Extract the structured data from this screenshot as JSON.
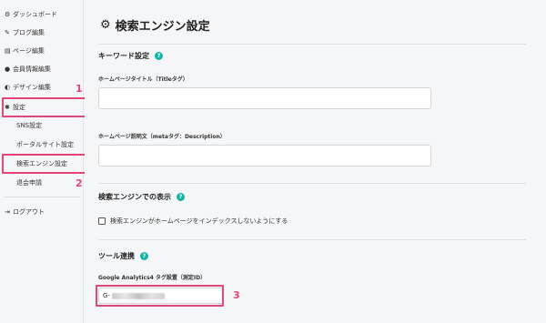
{
  "sidebar": {
    "items": [
      {
        "icon": "sliders",
        "label": "ダッシュボード"
      },
      {
        "icon": "pencil",
        "label": "ブログ編集"
      },
      {
        "icon": "pages",
        "label": "ページ編集"
      },
      {
        "icon": "user",
        "label": "会員情報編集"
      },
      {
        "icon": "palette",
        "label": "デザイン編集"
      },
      {
        "icon": "gear",
        "label": "設定"
      }
    ],
    "sub_items": [
      "SNS設定",
      "ポータルサイト設定",
      "検索エンジン設定",
      "退会申請"
    ],
    "logout": {
      "icon": "logout",
      "label": "ログアウト"
    }
  },
  "annotations": {
    "n1": "1",
    "n2": "2",
    "n3": "3"
  },
  "accent_color": "#e2467a",
  "help_color": "#17b3a3",
  "main": {
    "title": "検索エンジン設定",
    "keyword_section": {
      "title": "キーワード設定",
      "homepage_title_label": "ホームページタイトル（Titleタグ）",
      "homepage_title_value": "",
      "description_label": "ホームページ説明文（metaタグ：Description）",
      "description_value": ""
    },
    "display_section": {
      "title": "検索エンジンでの表示",
      "noindex_label": "検索エンジンがホームページをインデックスしないようにする",
      "noindex_checked": false
    },
    "tools_section": {
      "title": "ツール連携",
      "ga4_label": "Google Analytics4 タグ設置（測定ID）",
      "ga4_value_prefix": "G-"
    }
  }
}
